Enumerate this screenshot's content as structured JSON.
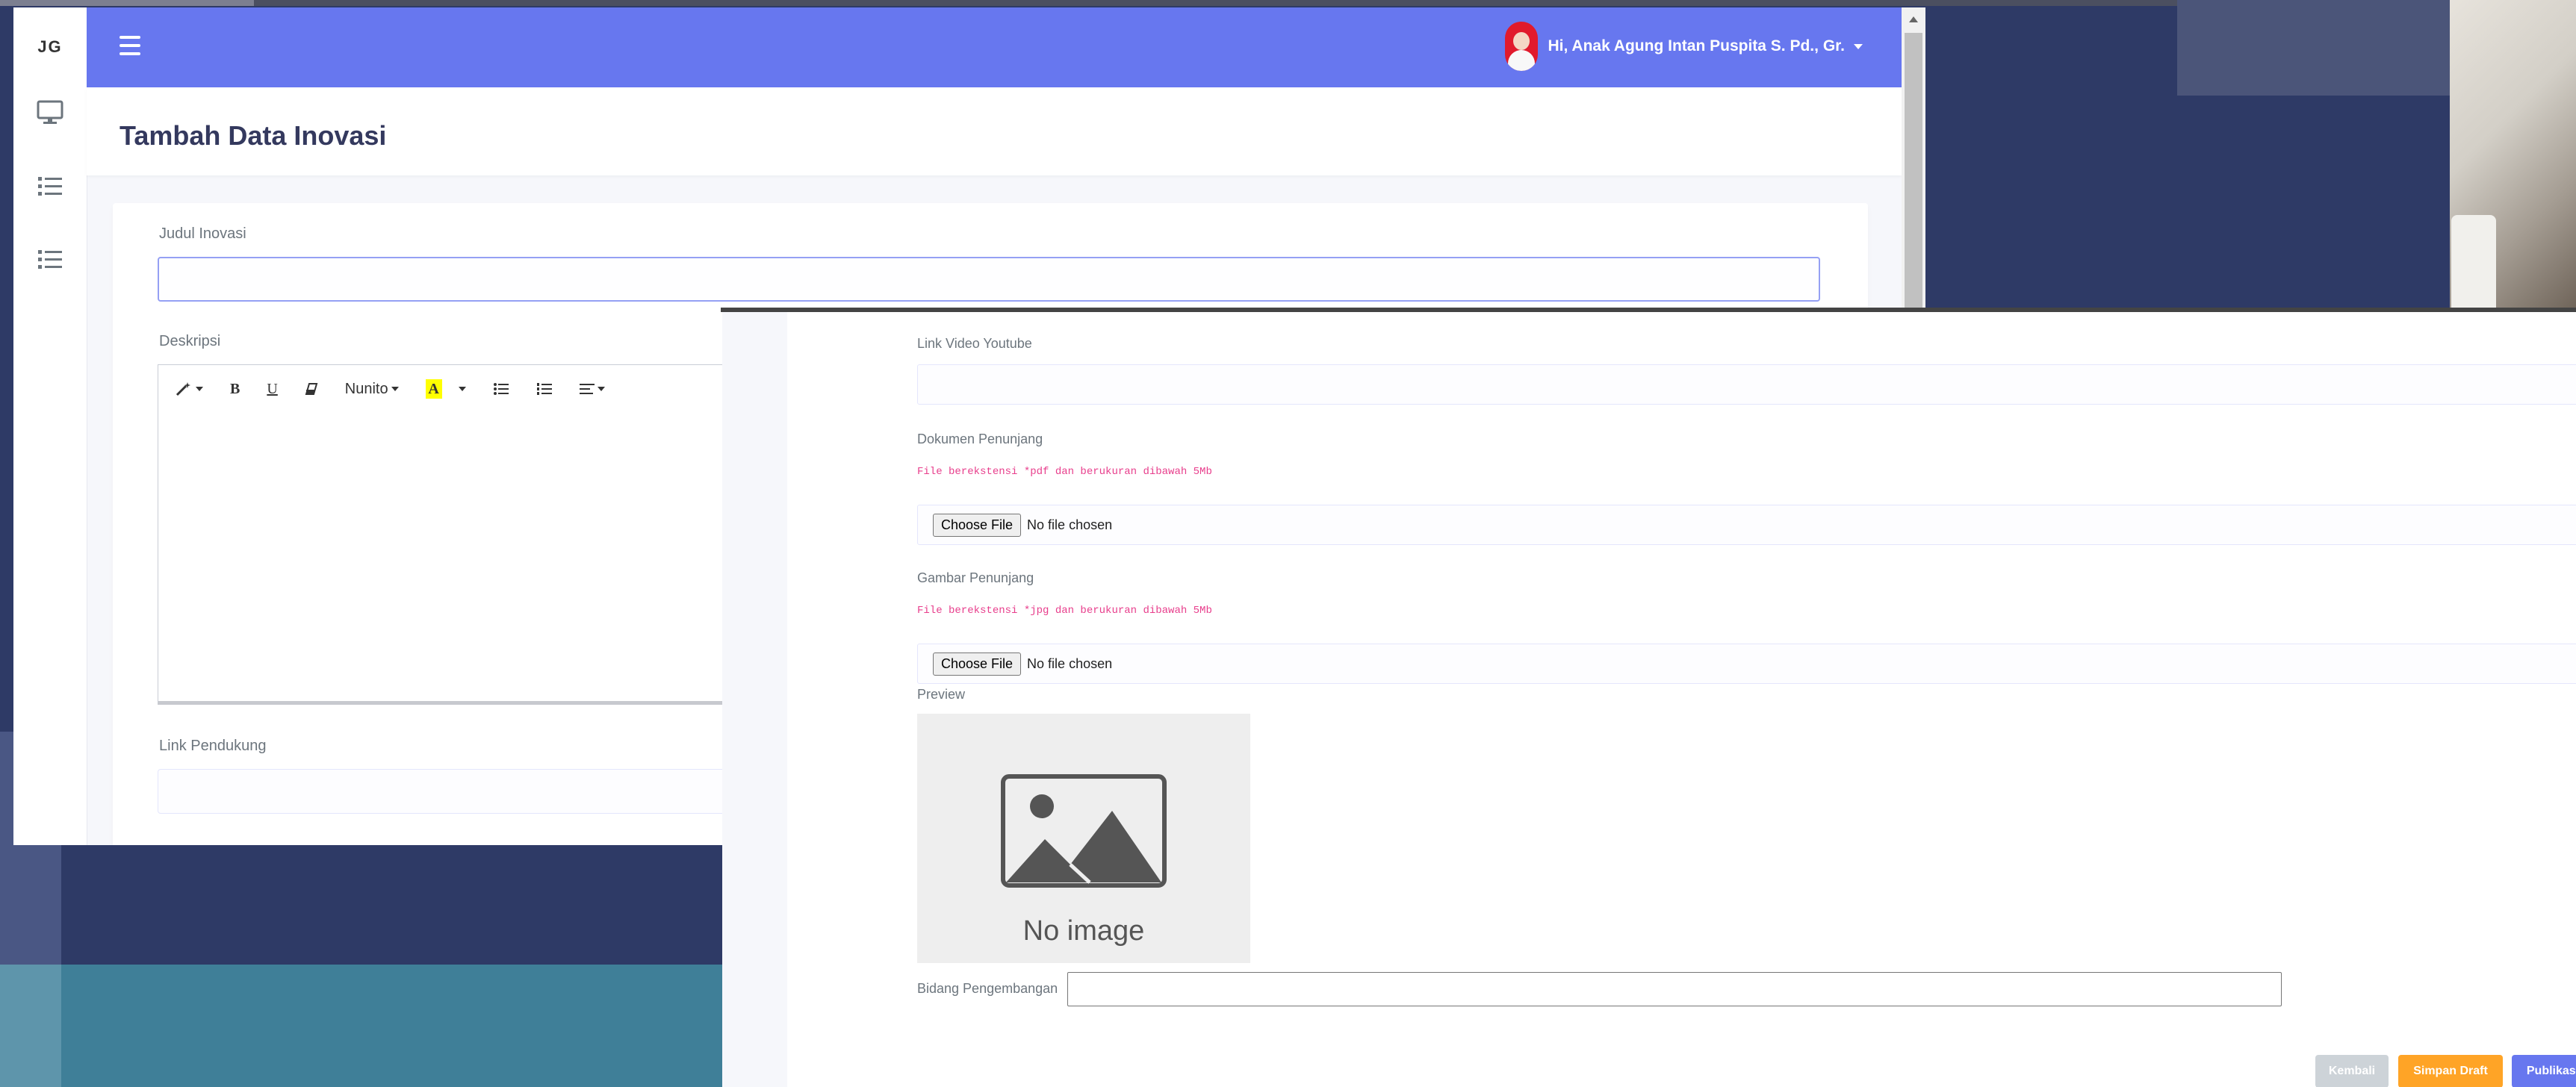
{
  "app": {
    "logo": "JG"
  },
  "header": {
    "greeting": "Hi, Anak Agung Intan Puspita S. Pd., Gr."
  },
  "page": {
    "title": "Tambah Data Inovasi"
  },
  "form": {
    "judul_label": "Judul Inovasi",
    "judul_value": "",
    "deskripsi_label": "Deskripsi",
    "link_pendukung_label": "Link Pendukung",
    "editor_toolbar": {
      "font_name": "Nunito",
      "highlight_glyph": "A"
    },
    "link_video_label": "Link Video Youtube",
    "dokumen_label": "Dokumen Penunjang",
    "dokumen_note": "File berekstensi *pdf dan berukuran dibawah 5Mb",
    "gambar_label": "Gambar Penunjang",
    "gambar_note": "File berekstensi *jpg dan berukuran dibawah 5Mb",
    "file_button": "Choose File",
    "file_status": "No file chosen",
    "preview_label": "Preview",
    "preview_placeholder": "No image",
    "bidang_label": "Bidang Pengembangan"
  },
  "actions": {
    "kembali": "Kembali",
    "simpan_draft": "Simpan Draft",
    "publikasi": "Publikasi"
  },
  "colors": {
    "primary": "#6777ef",
    "warning": "#ffa426",
    "muted": "#cdd3d8",
    "note": "#e83e8c"
  },
  "icons": {
    "sidebar": [
      "monitor-icon",
      "list-icon",
      "list-icon"
    ],
    "toolbar": [
      "magic-wand-icon",
      "bold-icon",
      "underline-icon",
      "eraser-icon",
      "font-dropdown",
      "highlight-icon",
      "unordered-list-icon",
      "ordered-list-icon",
      "align-icon"
    ]
  }
}
